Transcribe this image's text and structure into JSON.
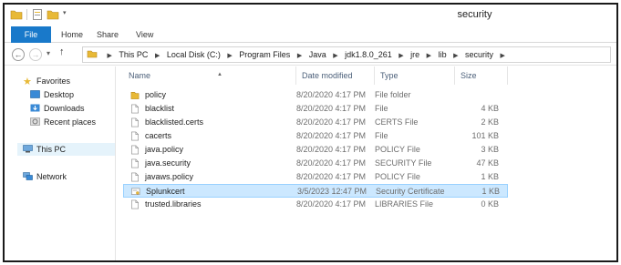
{
  "window": {
    "title": "security"
  },
  "ribbon": {
    "file": "File",
    "home": "Home",
    "share": "Share",
    "view": "View"
  },
  "address": {
    "segments": [
      "This PC",
      "Local Disk (C:)",
      "Program Files",
      "Java",
      "jdk1.8.0_261",
      "jre",
      "lib",
      "security"
    ]
  },
  "nav": {
    "favorites": "Favorites",
    "desktop": "Desktop",
    "downloads": "Downloads",
    "recent": "Recent places",
    "thispc": "This PC",
    "network": "Network"
  },
  "columns": {
    "name": "Name",
    "date": "Date modified",
    "type": "Type",
    "size": "Size"
  },
  "files": [
    {
      "name": "policy",
      "date": "8/20/2020 4:17 PM",
      "type": "File folder",
      "size": "",
      "icon": "folder-icon"
    },
    {
      "name": "blacklist",
      "date": "8/20/2020 4:17 PM",
      "type": "File",
      "size": "4 KB",
      "icon": "file-icon"
    },
    {
      "name": "blacklisted.certs",
      "date": "8/20/2020 4:17 PM",
      "type": "CERTS File",
      "size": "2 KB",
      "icon": "file-icon"
    },
    {
      "name": "cacerts",
      "date": "8/20/2020 4:17 PM",
      "type": "File",
      "size": "101 KB",
      "icon": "file-icon"
    },
    {
      "name": "java.policy",
      "date": "8/20/2020 4:17 PM",
      "type": "POLICY File",
      "size": "3 KB",
      "icon": "file-icon"
    },
    {
      "name": "java.security",
      "date": "8/20/2020 4:17 PM",
      "type": "SECURITY File",
      "size": "47 KB",
      "icon": "file-icon"
    },
    {
      "name": "javaws.policy",
      "date": "8/20/2020 4:17 PM",
      "type": "POLICY File",
      "size": "1 KB",
      "icon": "file-icon"
    },
    {
      "name": "Splunkcert",
      "date": "3/5/2023 12:47 PM",
      "type": "Security Certificate",
      "size": "1 KB",
      "icon": "certificate-icon"
    },
    {
      "name": "trusted.libraries",
      "date": "8/20/2020 4:17 PM",
      "type": "LIBRARIES File",
      "size": "0 KB",
      "icon": "file-icon"
    }
  ],
  "colors": {
    "accent": "#1979ca",
    "selection": "#cce8ff",
    "selection_border": "#99d1ff",
    "folder": "#e8b936"
  }
}
